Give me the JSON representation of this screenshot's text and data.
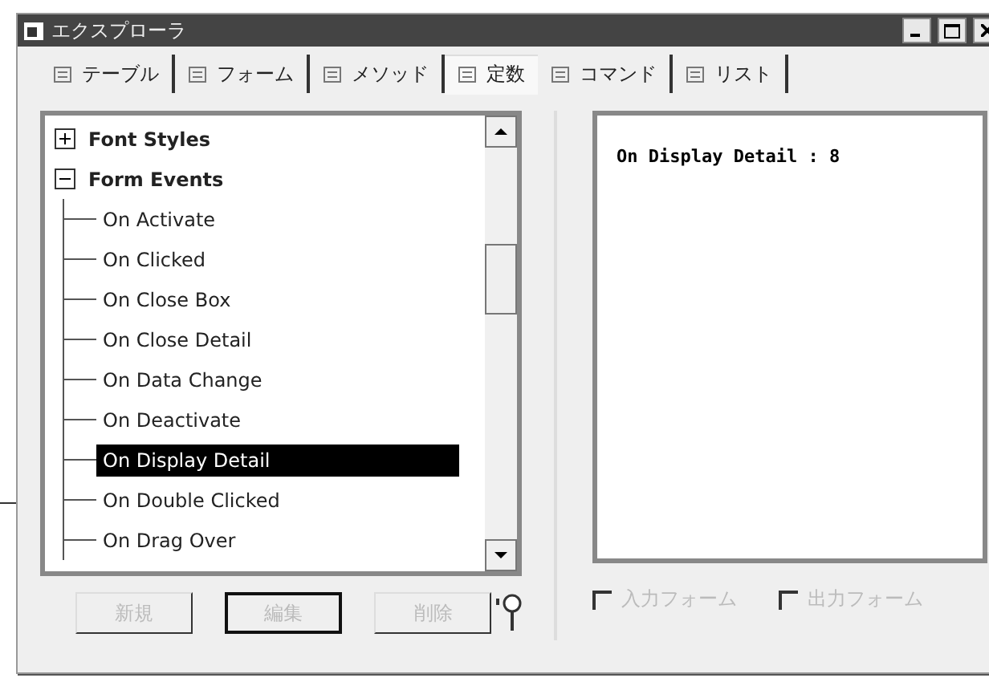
{
  "window": {
    "title": "エクスプローラ"
  },
  "tabs": [
    {
      "label": "テーブル",
      "selected": false
    },
    {
      "label": "フォーム",
      "selected": false
    },
    {
      "label": "メソッド",
      "selected": false
    },
    {
      "label": "定数",
      "selected": true
    },
    {
      "label": "コマンド",
      "selected": false
    },
    {
      "label": "リスト",
      "selected": false
    }
  ],
  "tree": [
    {
      "label": "Font Styles",
      "expanded": false,
      "selected": false
    },
    {
      "label": "Form Events",
      "expanded": true,
      "selected": false,
      "children": [
        {
          "label": "On Activate",
          "selected": false
        },
        {
          "label": "On Clicked",
          "selected": false
        },
        {
          "label": "On Close Box",
          "selected": false
        },
        {
          "label": "On Close Detail",
          "selected": false
        },
        {
          "label": "On Data Change",
          "selected": false
        },
        {
          "label": "On Deactivate",
          "selected": false
        },
        {
          "label": "On Display Detail",
          "selected": true
        },
        {
          "label": "On Double Clicked",
          "selected": false
        },
        {
          "label": "On Drag Over",
          "selected": false
        }
      ]
    }
  ],
  "detail": {
    "text": "On Display Detail : 8"
  },
  "buttons": [
    {
      "label": "新規",
      "disabled": true,
      "focused": false
    },
    {
      "label": "編集",
      "disabled": true,
      "focused": true
    },
    {
      "label": "削除",
      "disabled": true,
      "focused": false
    }
  ],
  "checkboxes": [
    {
      "label": "入力フォーム",
      "checked": false,
      "disabled": true
    },
    {
      "label": "出力フォーム",
      "checked": false,
      "disabled": true
    }
  ]
}
